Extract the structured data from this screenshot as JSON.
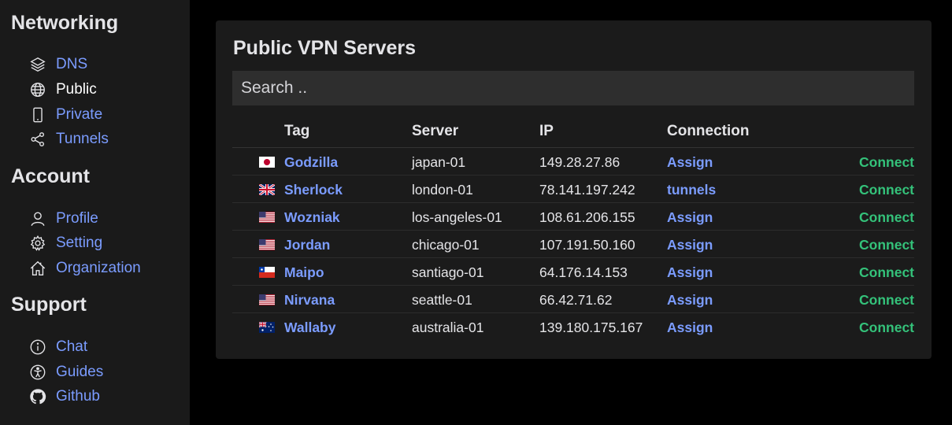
{
  "sidebar": {
    "sections": [
      {
        "title": "Networking",
        "items": [
          {
            "label": "DNS",
            "icon": "layers-icon"
          },
          {
            "label": "Public",
            "icon": "globe-icon",
            "active": true
          },
          {
            "label": "Private",
            "icon": "phone-icon"
          },
          {
            "label": "Tunnels",
            "icon": "share-icon"
          }
        ]
      },
      {
        "title": "Account",
        "items": [
          {
            "label": "Profile",
            "icon": "person-icon"
          },
          {
            "label": "Setting",
            "icon": "gear-icon"
          },
          {
            "label": "Organization",
            "icon": "house-icon"
          }
        ]
      },
      {
        "title": "Support",
        "items": [
          {
            "label": "Chat",
            "icon": "info-icon"
          },
          {
            "label": "Guides",
            "icon": "accessibility-icon"
          },
          {
            "label": "Github",
            "icon": "github-icon"
          }
        ]
      }
    ]
  },
  "main": {
    "title": "Public VPN Servers",
    "search": {
      "placeholder": "Search ..",
      "value": ""
    },
    "columns": [
      "Tag",
      "Server",
      "IP",
      "Connection"
    ],
    "rows": [
      {
        "flag": "japan-flag",
        "tag": "Godzilla",
        "server": "japan-01",
        "ip": "149.28.27.86",
        "connection": "Assign",
        "action": "Connect"
      },
      {
        "flag": "uk-flag",
        "tag": "Sherlock",
        "server": "london-01",
        "ip": "78.141.197.242",
        "connection": "tunnels",
        "action": "Connect"
      },
      {
        "flag": "us-flag",
        "tag": "Wozniak",
        "server": "los-angeles-01",
        "ip": "108.61.206.155",
        "connection": "Assign",
        "action": "Connect"
      },
      {
        "flag": "us-flag",
        "tag": "Jordan",
        "server": "chicago-01",
        "ip": "107.191.50.160",
        "connection": "Assign",
        "action": "Connect"
      },
      {
        "flag": "chile-flag",
        "tag": "Maipo",
        "server": "santiago-01",
        "ip": "64.176.14.153",
        "connection": "Assign",
        "action": "Connect"
      },
      {
        "flag": "us-flag",
        "tag": "Nirvana",
        "server": "seattle-01",
        "ip": "66.42.71.62",
        "connection": "Assign",
        "action": "Connect"
      },
      {
        "flag": "australia-flag",
        "tag": "Wallaby",
        "server": "australia-01",
        "ip": "139.180.175.167",
        "connection": "Assign",
        "action": "Connect"
      }
    ]
  },
  "colors": {
    "accent": "#7b9cff",
    "connect": "#34c27a",
    "sidebar_bg": "#1a1a1a",
    "card_bg": "#1b1b1b",
    "search_bg": "#2e2e2e"
  }
}
